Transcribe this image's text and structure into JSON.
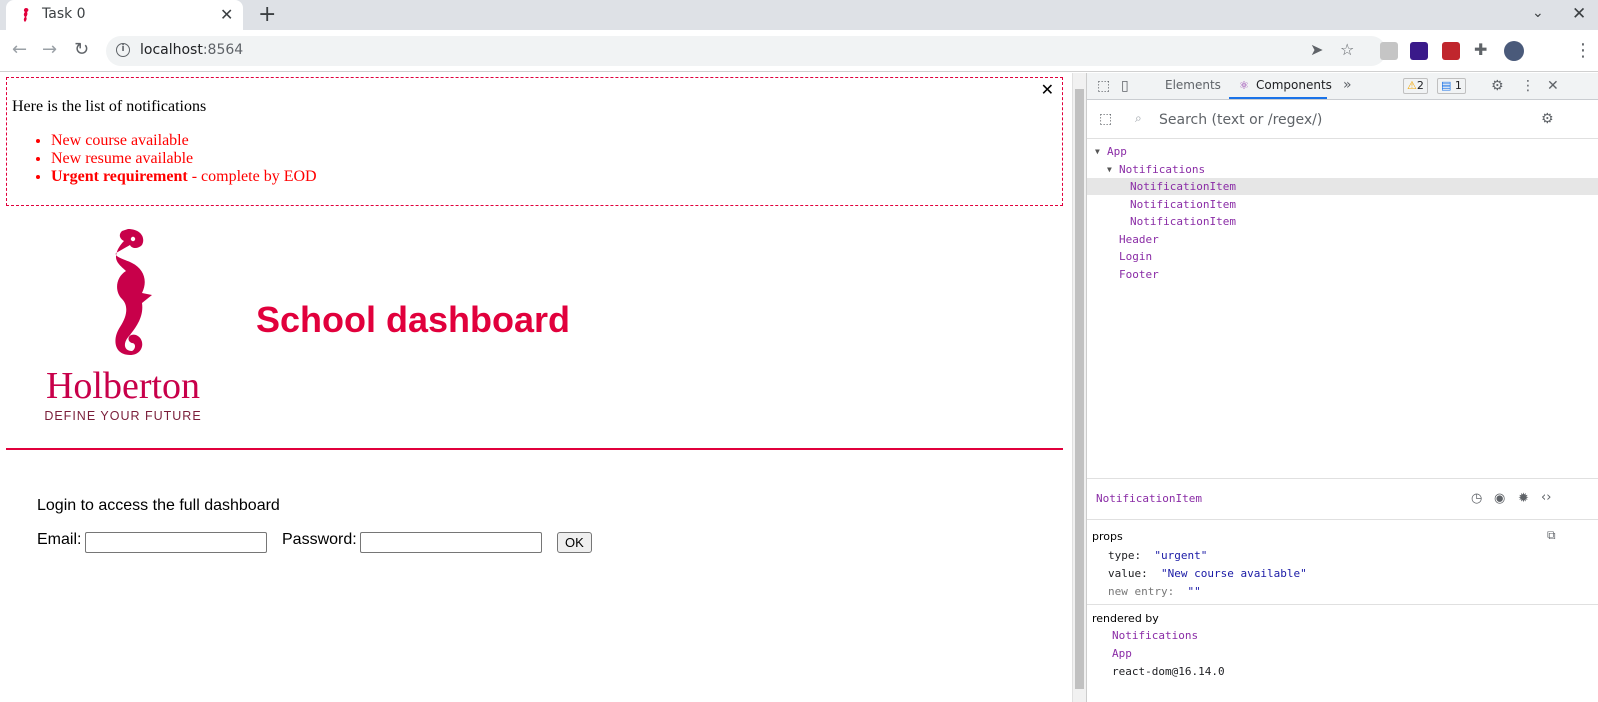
{
  "browser": {
    "tab_title": "Task 0",
    "url_host": "localhost",
    "url_port": ":8564"
  },
  "notifications": {
    "close_label": "✕",
    "title": "Here is the list of notifications",
    "items": [
      {
        "text": "New course available"
      },
      {
        "text": "New resume available"
      },
      {
        "bold": "Urgent requirement",
        "rest": " - complete by EOD"
      }
    ]
  },
  "header": {
    "brand": "Holberton",
    "tagline": "DEFINE YOUR FUTURE",
    "title": "School dashboard"
  },
  "login": {
    "intro": "Login to access the full dashboard",
    "email_label": "Email:",
    "password_label": "Password:",
    "submit_label": "OK"
  },
  "devtools": {
    "tabs": [
      "Elements",
      "Components"
    ],
    "warning_count": "2",
    "message_count": "1",
    "search_placeholder": "Search (text or /regex/)",
    "tree": [
      {
        "label": "App"
      },
      {
        "label": "Notifications"
      },
      {
        "label": "NotificationItem"
      },
      {
        "label": "NotificationItem"
      },
      {
        "label": "NotificationItem"
      },
      {
        "label": "Header"
      },
      {
        "label": "Login"
      },
      {
        "label": "Footer"
      }
    ],
    "selected_component": "NotificationItem",
    "props_label": "props",
    "props": [
      {
        "key": "type:",
        "value": "\"urgent\""
      },
      {
        "key": "value:",
        "value": "\"New course available\""
      },
      {
        "key": "new entry:",
        "value": "\"\""
      }
    ],
    "rendered_by_label": "rendered by",
    "rendered_by": [
      "Notifications",
      "App",
      "react-dom@16.14.0"
    ]
  },
  "colors": {
    "brand": "#e1003c",
    "notification_text": "#ff0000",
    "component_name": "#8a2ca6"
  }
}
